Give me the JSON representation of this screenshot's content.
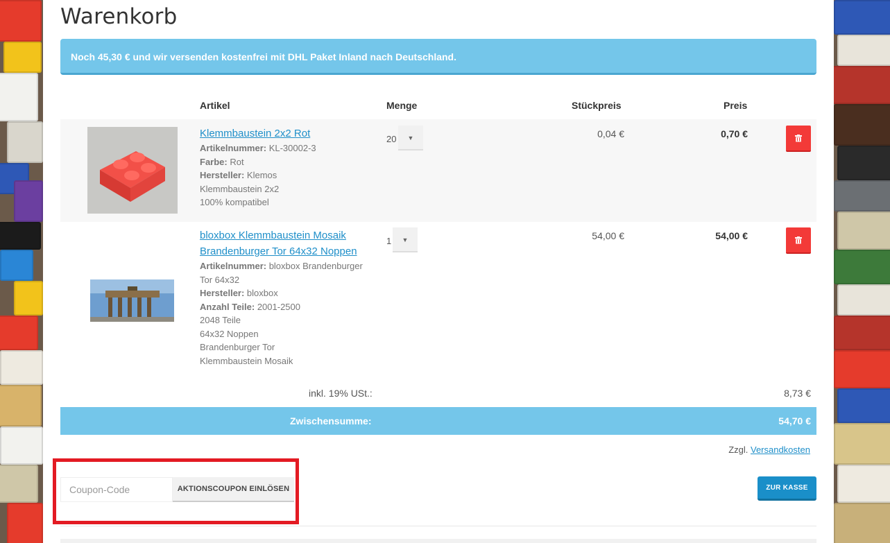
{
  "page": {
    "title": "Warenkorb",
    "notice": "Noch 45,30 € und wir versenden kostenfrei mit DHL Paket Inland nach Deutschland."
  },
  "table": {
    "headers": {
      "article": "Artikel",
      "quantity": "Menge",
      "unit_price": "Stückpreis",
      "price": "Preis"
    }
  },
  "items": [
    {
      "title": "Klemmbaustein 2x2 Rot",
      "attributes": [
        {
          "label": "Artikelnummer:",
          "value": " KL-30002-3"
        },
        {
          "label": "Farbe:",
          "value": " Rot"
        },
        {
          "label": "Hersteller:",
          "value": " Klemos"
        }
      ],
      "notes": [
        "Klemmbaustein 2x2",
        "100% kompatibel"
      ],
      "quantity": "20",
      "unit_price": "0,04 €",
      "price": "0,70 €"
    },
    {
      "title_line1": "bloxbox Klemmbaustein Mosaik",
      "title_line2": "Brandenburger Tor 64x32 Noppen",
      "attributes": [
        {
          "label": "Artikelnummer:",
          "value": " bloxbox Brandenburger"
        },
        {
          "label": "",
          "value": "Tor 64x32"
        },
        {
          "label": "Hersteller:",
          "value": " bloxbox"
        },
        {
          "label": "Anzahl Teile:",
          "value": " 2001-2500"
        }
      ],
      "notes": [
        "2048 Teile",
        "64x32 Noppen",
        "Brandenburger Tor",
        "Klemmbaustein Mosaik"
      ],
      "quantity": "1",
      "unit_price": "54,00 €",
      "price": "54,00 €"
    }
  ],
  "totals": {
    "tax_label": "inkl. 19% USt.:",
    "tax_value": "8,73 €",
    "subtotal_label": "Zwischensumme:",
    "subtotal_value": "54,70 €",
    "shipping_prefix": "Zzgl.",
    "shipping_link": "Versandkosten"
  },
  "coupon": {
    "placeholder": "Coupon-Code",
    "button": "AKTIONSCOUPON EINLÖSEN"
  },
  "checkout": {
    "button": "ZUR KASSE"
  },
  "colors": {
    "accent": "#74c6ea",
    "link": "#1f8fc9",
    "delete": "#f33a38",
    "highlight": "#e31b23",
    "checkout": "#1a8fc9"
  },
  "icons": {
    "delete": "trash-icon",
    "dropdown": "caret-down-icon"
  }
}
